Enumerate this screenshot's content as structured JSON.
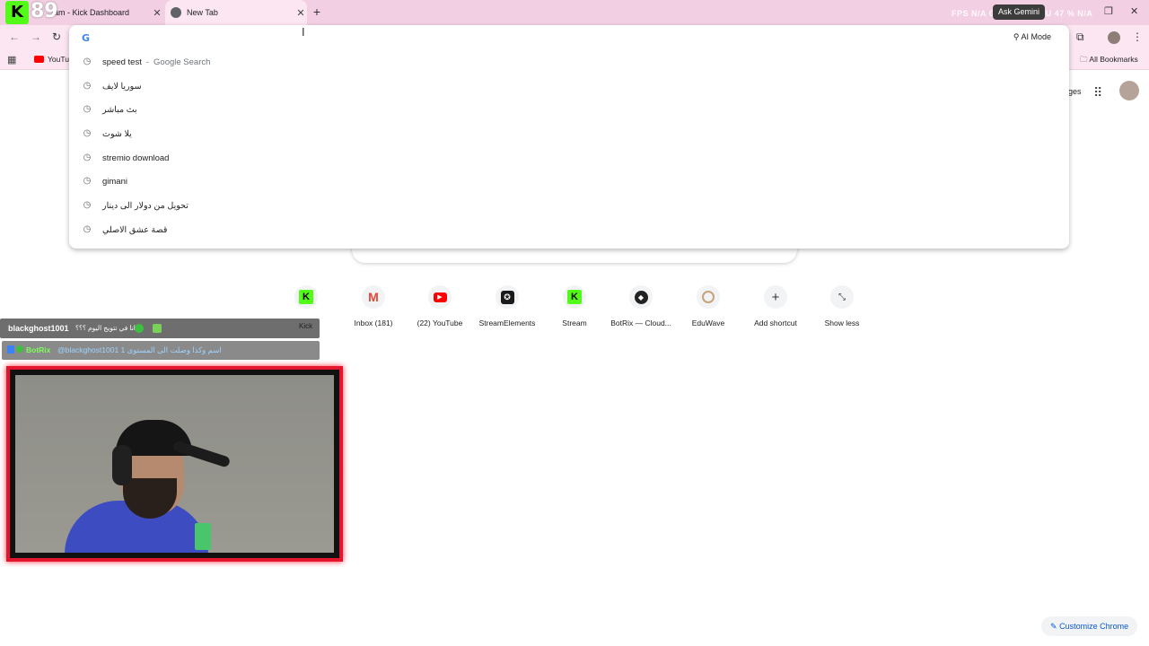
{
  "tabs": [
    {
      "title": "am - Kick Dashboard"
    },
    {
      "title": "New Tab"
    }
  ],
  "overlay": {
    "k_letter": "K",
    "counter": "89",
    "stats_text": "FPS N/A  GPU 32 %  CPU 47 %  N/A",
    "ask_gemini": "Ask Gemini"
  },
  "toolbar": {
    "ai_mode": "AI Mode"
  },
  "bookmarks": {
    "youtube": "YouTu",
    "all_bookmarks": "All Bookmarks"
  },
  "omnibox": {
    "suggestions": [
      {
        "text": "speed test",
        "aux": "Google Search"
      },
      {
        "text": "سوريا لايف"
      },
      {
        "text": "بث مباشر"
      },
      {
        "text": "يلا شوت"
      },
      {
        "text": "stremio download"
      },
      {
        "text": "gimani"
      },
      {
        "text": "تحويل من دولار الى دينار"
      },
      {
        "text": "قصة عشق الاصلي"
      }
    ]
  },
  "ntp": {
    "images_link": "ges",
    "shortcuts": [
      {
        "label": "Kick"
      },
      {
        "label": "Inbox (181)"
      },
      {
        "label": "(22) YouTube"
      },
      {
        "label": "StreamElements"
      },
      {
        "label": "Stream"
      },
      {
        "label": "BotRix — Cloud..."
      },
      {
        "label": "EduWave"
      },
      {
        "label": "Add shortcut"
      },
      {
        "label": "Show less"
      }
    ],
    "customize": "Customize Chrome"
  },
  "chat": {
    "msg1_user": "blackghost1001",
    "msg1_text": "انا في تتويج اليوم ؟؟؟",
    "msg1_tag": "Kick",
    "msg2_user": "BotRix",
    "msg2_text": "@blackghost1001 اسم وكذا وصلت الى المستوى 1"
  },
  "colors": {
    "kick_green": "#53fc18",
    "tabstrip": "#f3cfe3",
    "cam_border": "#e3162e",
    "youtube_red": "#ff0000",
    "gmail_red": "#ea4335"
  }
}
